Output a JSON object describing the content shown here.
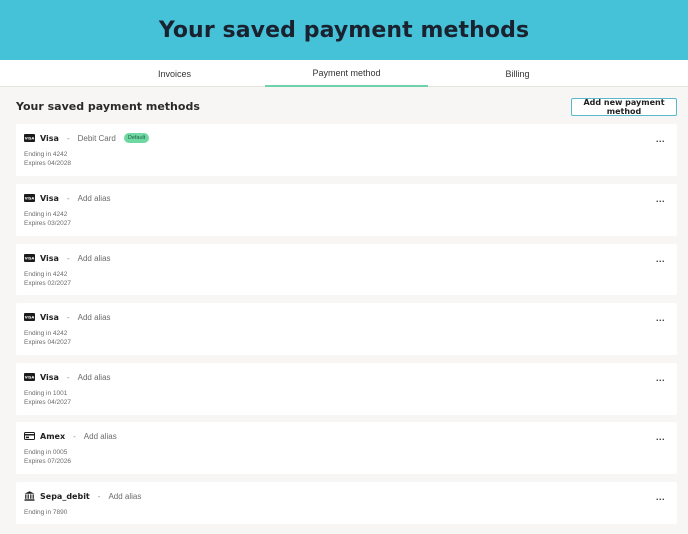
{
  "header": {
    "title": "Your saved payment methods"
  },
  "tabs": [
    {
      "label": "Invoices",
      "active": false
    },
    {
      "label": "Payment method",
      "active": true
    },
    {
      "label": "Billing",
      "active": false
    }
  ],
  "section": {
    "title": "Your saved payment methods",
    "add_button_label": "Add new payment method"
  },
  "colors": {
    "banner": "#45c2d8",
    "active_tab": "#6fd0ad",
    "default_badge": "#6fd8a2"
  },
  "more_label": "...",
  "separator": "-",
  "methods": [
    {
      "brand": "Visa",
      "icon": "visa-icon",
      "alias": "Debit Card",
      "badge": "Default",
      "ending": "Ending in 4242",
      "expires": "Expires 04/2028"
    },
    {
      "brand": "Visa",
      "icon": "visa-icon",
      "alias": "Add alias",
      "ending": "Ending in 4242",
      "expires": "Expires 03/2027"
    },
    {
      "brand": "Visa",
      "icon": "visa-icon",
      "alias": "Add alias",
      "ending": "Ending in 4242",
      "expires": "Expires 02/2027"
    },
    {
      "brand": "Visa",
      "icon": "visa-icon",
      "alias": "Add alias",
      "ending": "Ending in 4242",
      "expires": "Expires 04/2027"
    },
    {
      "brand": "Visa",
      "icon": "visa-icon",
      "alias": "Add alias",
      "ending": "Ending in 1001",
      "expires": "Expires 04/2027"
    },
    {
      "brand": "Amex",
      "icon": "card-icon",
      "alias": "Add alias",
      "ending": "Ending in 0005",
      "expires": "Expires 07/2026"
    },
    {
      "brand": "Sepa_debit",
      "icon": "bank-icon",
      "alias": "Add alias",
      "ending": "Ending in 7890"
    }
  ]
}
